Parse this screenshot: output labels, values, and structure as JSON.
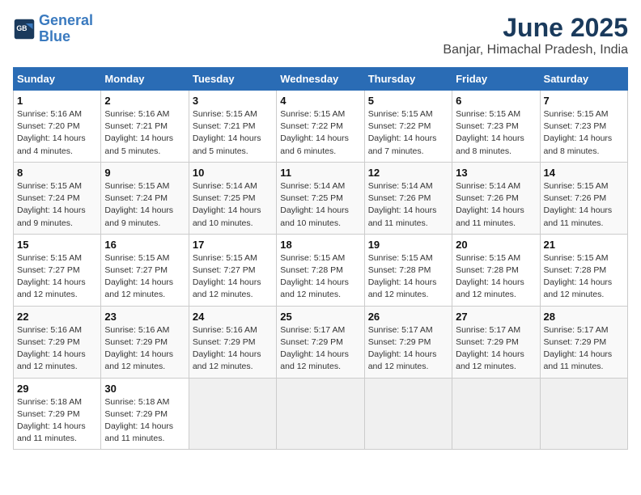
{
  "header": {
    "logo_line1": "General",
    "logo_line2": "Blue",
    "month_year": "June 2025",
    "location": "Banjar, Himachal Pradesh, India"
  },
  "columns": [
    "Sunday",
    "Monday",
    "Tuesday",
    "Wednesday",
    "Thursday",
    "Friday",
    "Saturday"
  ],
  "weeks": [
    [
      {
        "day": "1",
        "sunrise": "5:16 AM",
        "sunset": "7:20 PM",
        "daylight": "14 hours and 4 minutes."
      },
      {
        "day": "2",
        "sunrise": "5:16 AM",
        "sunset": "7:21 PM",
        "daylight": "14 hours and 5 minutes."
      },
      {
        "day": "3",
        "sunrise": "5:15 AM",
        "sunset": "7:21 PM",
        "daylight": "14 hours and 5 minutes."
      },
      {
        "day": "4",
        "sunrise": "5:15 AM",
        "sunset": "7:22 PM",
        "daylight": "14 hours and 6 minutes."
      },
      {
        "day": "5",
        "sunrise": "5:15 AM",
        "sunset": "7:22 PM",
        "daylight": "14 hours and 7 minutes."
      },
      {
        "day": "6",
        "sunrise": "5:15 AM",
        "sunset": "7:23 PM",
        "daylight": "14 hours and 8 minutes."
      },
      {
        "day": "7",
        "sunrise": "5:15 AM",
        "sunset": "7:23 PM",
        "daylight": "14 hours and 8 minutes."
      }
    ],
    [
      {
        "day": "8",
        "sunrise": "5:15 AM",
        "sunset": "7:24 PM",
        "daylight": "14 hours and 9 minutes."
      },
      {
        "day": "9",
        "sunrise": "5:15 AM",
        "sunset": "7:24 PM",
        "daylight": "14 hours and 9 minutes."
      },
      {
        "day": "10",
        "sunrise": "5:14 AM",
        "sunset": "7:25 PM",
        "daylight": "14 hours and 10 minutes."
      },
      {
        "day": "11",
        "sunrise": "5:14 AM",
        "sunset": "7:25 PM",
        "daylight": "14 hours and 10 minutes."
      },
      {
        "day": "12",
        "sunrise": "5:14 AM",
        "sunset": "7:26 PM",
        "daylight": "14 hours and 11 minutes."
      },
      {
        "day": "13",
        "sunrise": "5:14 AM",
        "sunset": "7:26 PM",
        "daylight": "14 hours and 11 minutes."
      },
      {
        "day": "14",
        "sunrise": "5:15 AM",
        "sunset": "7:26 PM",
        "daylight": "14 hours and 11 minutes."
      }
    ],
    [
      {
        "day": "15",
        "sunrise": "5:15 AM",
        "sunset": "7:27 PM",
        "daylight": "14 hours and 12 minutes."
      },
      {
        "day": "16",
        "sunrise": "5:15 AM",
        "sunset": "7:27 PM",
        "daylight": "14 hours and 12 minutes."
      },
      {
        "day": "17",
        "sunrise": "5:15 AM",
        "sunset": "7:27 PM",
        "daylight": "14 hours and 12 minutes."
      },
      {
        "day": "18",
        "sunrise": "5:15 AM",
        "sunset": "7:28 PM",
        "daylight": "14 hours and 12 minutes."
      },
      {
        "day": "19",
        "sunrise": "5:15 AM",
        "sunset": "7:28 PM",
        "daylight": "14 hours and 12 minutes."
      },
      {
        "day": "20",
        "sunrise": "5:15 AM",
        "sunset": "7:28 PM",
        "daylight": "14 hours and 12 minutes."
      },
      {
        "day": "21",
        "sunrise": "5:15 AM",
        "sunset": "7:28 PM",
        "daylight": "14 hours and 12 minutes."
      }
    ],
    [
      {
        "day": "22",
        "sunrise": "5:16 AM",
        "sunset": "7:29 PM",
        "daylight": "14 hours and 12 minutes."
      },
      {
        "day": "23",
        "sunrise": "5:16 AM",
        "sunset": "7:29 PM",
        "daylight": "14 hours and 12 minutes."
      },
      {
        "day": "24",
        "sunrise": "5:16 AM",
        "sunset": "7:29 PM",
        "daylight": "14 hours and 12 minutes."
      },
      {
        "day": "25",
        "sunrise": "5:17 AM",
        "sunset": "7:29 PM",
        "daylight": "14 hours and 12 minutes."
      },
      {
        "day": "26",
        "sunrise": "5:17 AM",
        "sunset": "7:29 PM",
        "daylight": "14 hours and 12 minutes."
      },
      {
        "day": "27",
        "sunrise": "5:17 AM",
        "sunset": "7:29 PM",
        "daylight": "14 hours and 12 minutes."
      },
      {
        "day": "28",
        "sunrise": "5:17 AM",
        "sunset": "7:29 PM",
        "daylight": "14 hours and 11 minutes."
      }
    ],
    [
      {
        "day": "29",
        "sunrise": "5:18 AM",
        "sunset": "7:29 PM",
        "daylight": "14 hours and 11 minutes."
      },
      {
        "day": "30",
        "sunrise": "5:18 AM",
        "sunset": "7:29 PM",
        "daylight": "14 hours and 11 minutes."
      },
      null,
      null,
      null,
      null,
      null
    ]
  ],
  "labels": {
    "sunrise": "Sunrise:",
    "sunset": "Sunset:",
    "daylight": "Daylight:"
  }
}
